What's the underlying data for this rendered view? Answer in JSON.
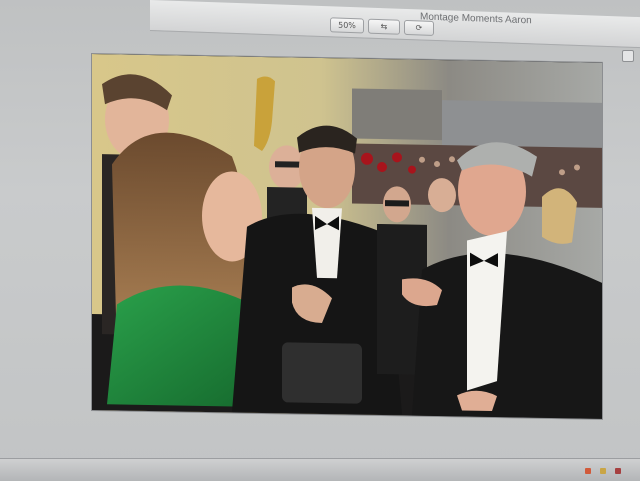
{
  "window": {
    "title": "Montage Moments Aaron",
    "toolbar_buttons": [
      "50%",
      "⇆",
      "⟳"
    ]
  },
  "colors": {
    "accent_dress": "#1f8a3c",
    "carpet": "#b0171f",
    "gold_statue": "#c9a23a"
  },
  "icons": [
    "close-window-icon"
  ]
}
